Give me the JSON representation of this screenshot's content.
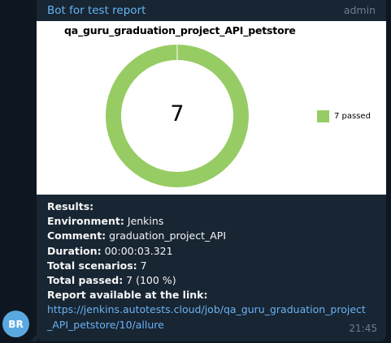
{
  "avatar": {
    "initials": "BR"
  },
  "message": {
    "sender": "Bot for test report",
    "role": "admin",
    "time": "21:45",
    "chart": {
      "title": "qa_guru_graduation_project_API_petstore"
    },
    "results_heading": "Results:",
    "environment": {
      "label": "Environment:",
      "value": " Jenkins"
    },
    "comment": {
      "label": "Comment:",
      "value": " graduation_project_API"
    },
    "duration": {
      "label": "Duration:",
      "value": " 00:00:03.321"
    },
    "total_scenarios": {
      "label": "Total scenarios:",
      "value": " 7"
    },
    "total_passed": {
      "label": "Total passed:",
      "value": " 7 (100 %)"
    },
    "report_label": "Report available at the link:",
    "report_link": "https://jenkins.autotests.cloud/job/qa_guru_graduation_project_API_petstore/10/allure"
  },
  "chart_data": {
    "type": "pie",
    "title": "qa_guru_graduation_project_API_petstore",
    "center_label": "7",
    "slices": [
      {
        "label": "7 passed",
        "value": 7,
        "color": "#97cc64"
      }
    ],
    "legend_position": "right"
  }
}
